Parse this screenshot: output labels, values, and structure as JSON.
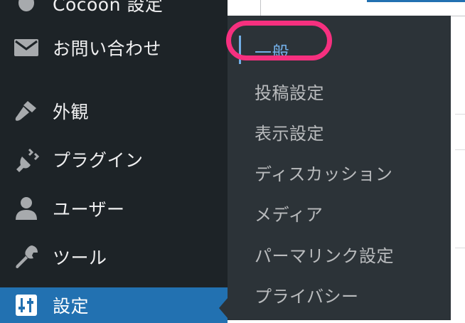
{
  "sidebar": {
    "items": [
      {
        "label": "Cocoon 設定",
        "icon": "cocoon-icon"
      },
      {
        "label": "お問い合わせ",
        "icon": "mail-icon"
      },
      {
        "label": "外観",
        "icon": "paintbrush-icon"
      },
      {
        "label": "プラグイン",
        "icon": "plugin-icon"
      },
      {
        "label": "ユーザー",
        "icon": "user-icon"
      },
      {
        "label": "ツール",
        "icon": "wrench-icon"
      },
      {
        "label": "設定",
        "icon": "settings-sliders-icon",
        "current": true
      }
    ]
  },
  "submenu": {
    "items": [
      {
        "label": "一般",
        "current": true
      },
      {
        "label": "投稿設定"
      },
      {
        "label": "表示設定"
      },
      {
        "label": "ディスカッション"
      },
      {
        "label": "メディア"
      },
      {
        "label": "パーマリンク設定"
      },
      {
        "label": "プライバシー"
      }
    ]
  },
  "colors": {
    "sidebar_bg": "#1d2327",
    "submenu_bg": "#2c3338",
    "current_bg": "#2271b1",
    "current_text": "#72aee6",
    "highlight_ring": "#f6307f"
  }
}
